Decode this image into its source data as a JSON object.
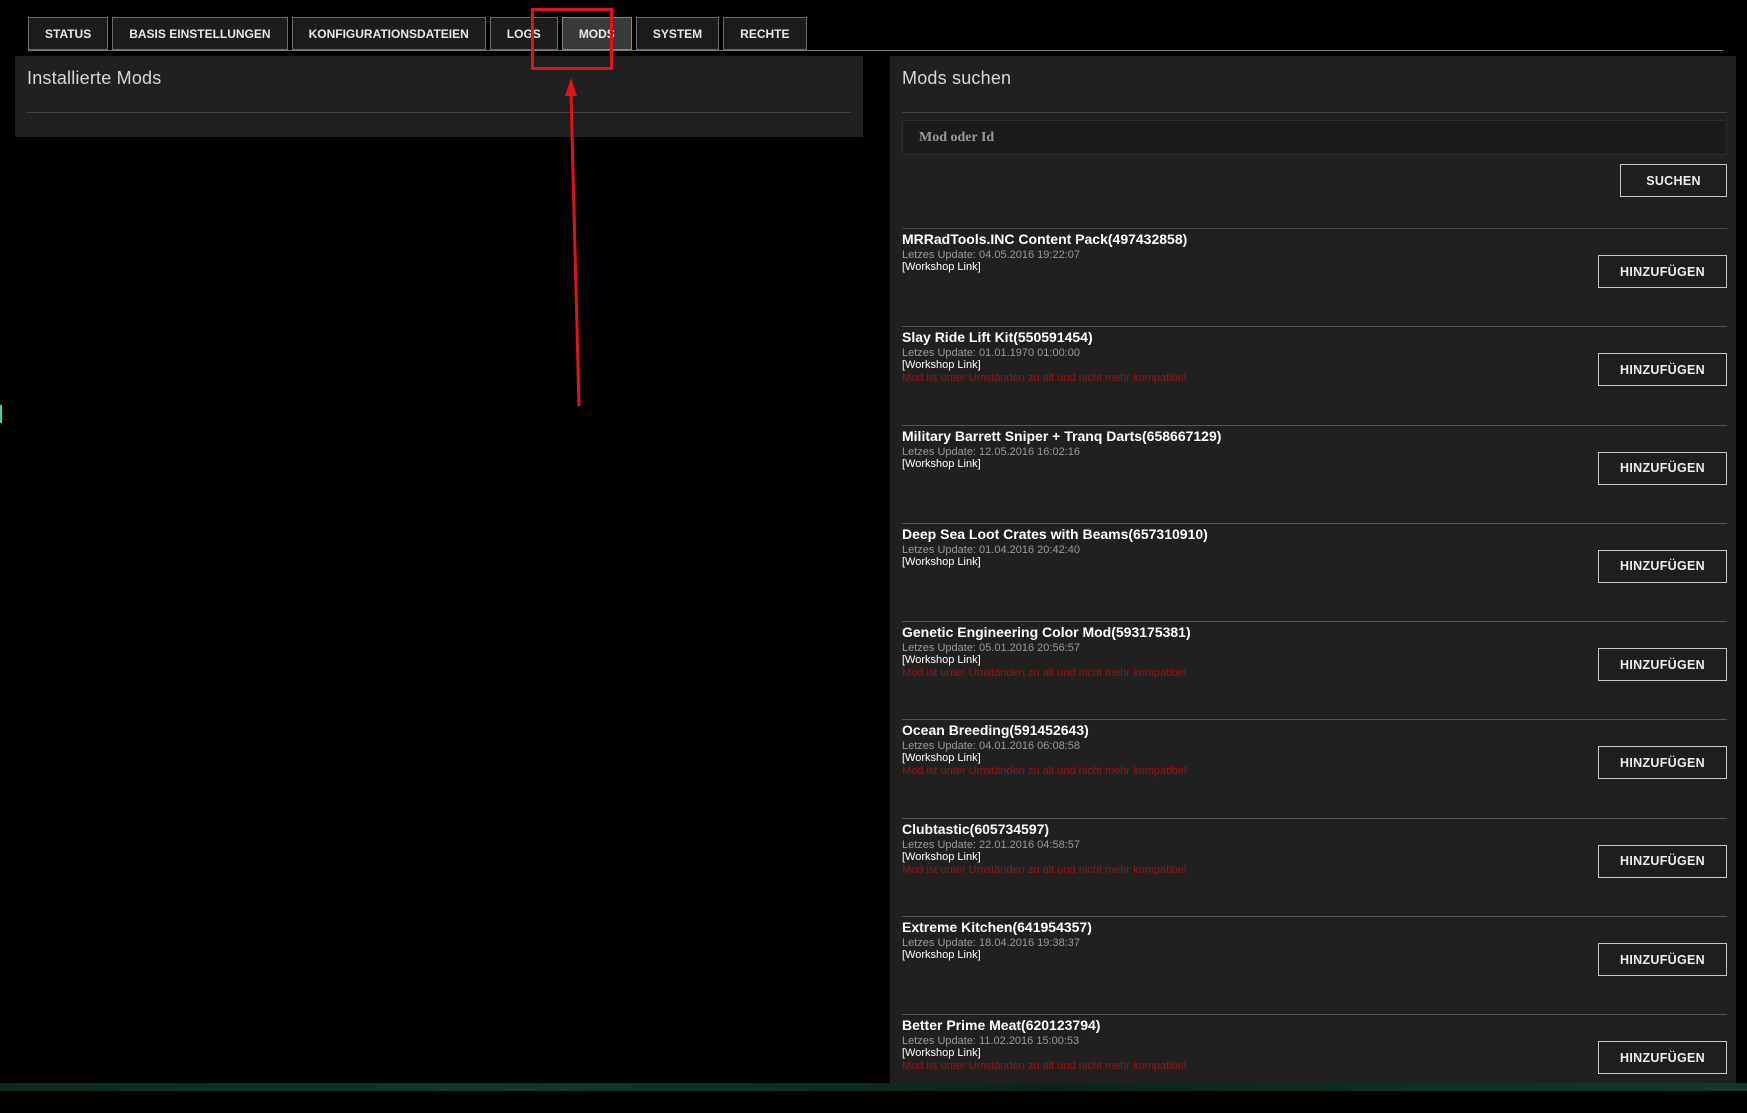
{
  "tabs": [
    {
      "label": "STATUS",
      "active": false
    },
    {
      "label": "BASIS EINSTELLUNGEN",
      "active": false
    },
    {
      "label": "KONFIGURATIONSDATEIEN",
      "active": false
    },
    {
      "label": "LOGS",
      "active": false
    },
    {
      "label": "MODS",
      "active": true
    },
    {
      "label": "SYSTEM",
      "active": false
    },
    {
      "label": "RECHTE",
      "active": false
    }
  ],
  "installed": {
    "title": "Installierte Mods"
  },
  "search": {
    "title": "Mods suchen",
    "placeholder": "Mod oder Id",
    "button_label": "SUCHEN"
  },
  "add_label": "HINZUFÜGEN",
  "mods": [
    {
      "name": "MRRadTools.INC Content Pack(497432858)",
      "date": "Letzes Update: 04.05.2016 19:22:07",
      "link": "[Workshop Link]",
      "warning": ""
    },
    {
      "name": "Slay Ride Lift Kit(550591454)",
      "date": "Letzes Update: 01.01.1970 01:00:00",
      "link": "[Workshop Link]",
      "warning": "Mod ist unter Umständen zu alt und nicht mehr kompatibel"
    },
    {
      "name": "Military Barrett Sniper + Tranq Darts(658667129)",
      "date": "Letzes Update: 12.05.2016 16:02:16",
      "link": "[Workshop Link]",
      "warning": ""
    },
    {
      "name": "Deep Sea Loot Crates with Beams(657310910)",
      "date": "Letzes Update: 01.04.2016 20:42:40",
      "link": "[Workshop Link]",
      "warning": ""
    },
    {
      "name": "Genetic Engineering Color Mod(593175381)",
      "date": "Letzes Update: 05.01.2016 20:56:57",
      "link": "[Workshop Link]",
      "warning": "Mod ist unter Umständen zu alt und nicht mehr kompatibel"
    },
    {
      "name": "Ocean Breeding(591452643)",
      "date": "Letzes Update: 04.01.2016 06:08:58",
      "link": "[Workshop Link]",
      "warning": "Mod ist unter Umständen zu alt und nicht mehr kompatibel"
    },
    {
      "name": "Clubtastic(605734597)",
      "date": "Letzes Update: 22.01.2016 04:58:57",
      "link": "[Workshop Link]",
      "warning": "Mod ist unter Umständen zu alt und nicht mehr kompatibel"
    },
    {
      "name": "Extreme Kitchen(641954357)",
      "date": "Letzes Update: 18.04.2016 19:38:37",
      "link": "[Workshop Link]",
      "warning": ""
    },
    {
      "name": "Better Prime Meat(620123794)",
      "date": "Letzes Update: 11.02.2016 15:00:53",
      "link": "[Workshop Link]",
      "warning": "Mod ist unter Umständen zu alt und nicht mehr kompatibel"
    }
  ],
  "colors": {
    "warning": "#9d1313",
    "annotation": "#e01414",
    "panel": "#202020"
  }
}
